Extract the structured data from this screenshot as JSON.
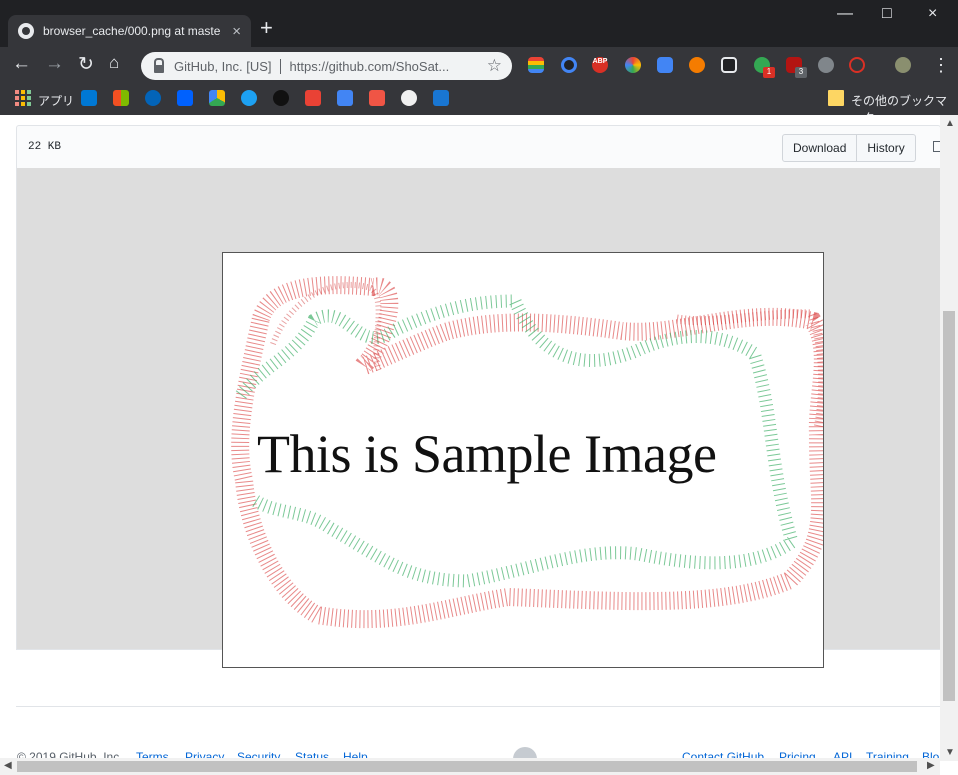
{
  "browser": {
    "tab_title": "browser_cache/000.png at maste",
    "tab_close": "×",
    "new_tab": "+",
    "window_controls": [
      "—",
      "□",
      "×"
    ],
    "omnibox_site": "GitHub, Inc. [US]",
    "omnibox_url": "https://github.com/ShoSat...",
    "star": "☆",
    "menu": "⋮",
    "nav_icons": [
      "back-icon",
      "forward-icon",
      "reload-icon",
      "home-icon"
    ],
    "extensions": [
      {
        "name": "stack-extension-icon",
        "color": "#34a853"
      },
      {
        "name": "color-extension-icon",
        "color": "#4285f4"
      },
      {
        "name": "adblock-extension-icon",
        "color": "#d93025",
        "label": "ABP"
      },
      {
        "name": "colorful-extension-icon",
        "color": "#fbbc04"
      },
      {
        "name": "translate-extension-icon",
        "color": "#4285f4"
      },
      {
        "name": "owl-extension-icon",
        "color": "#f57c00"
      },
      {
        "name": "video-extension-icon",
        "color": "#5f6368"
      },
      {
        "name": "green-extension-icon",
        "color": "#34a853",
        "badge": "1"
      },
      {
        "name": "ublock-extension-icon",
        "color": "#b31412",
        "badge": "3"
      },
      {
        "name": "lamp-extension-icon",
        "color": "#80868b"
      },
      {
        "name": "block-extension-icon",
        "color": "#d93025"
      }
    ]
  },
  "bookmarks": {
    "apps_label": "アプリ",
    "other_label": "その他のブックマーク",
    "items": [
      "bing-bookmark-icon",
      "microsoft-bookmark-icon",
      "onedrive-bookmark-icon",
      "dropbox-bookmark-icon",
      "drive-bookmark-icon",
      "twitter-bookmark-icon",
      "apple-bookmark-icon",
      "star-bookmark-icon",
      "cloud-bookmark-icon",
      "anki-bookmark-icon",
      "github-bookmark-icon",
      "code-bookmark-icon"
    ]
  },
  "github": {
    "file_size": "22 KB",
    "download_label": "Download",
    "history_label": "History",
    "sample_text": "This is Sample Image"
  },
  "footer": {
    "copyright": "© 2019 GitHub, Inc.",
    "left_links": [
      "Terms",
      "Privacy",
      "Security",
      "Status",
      "Help"
    ],
    "right_links": [
      "Contact GitHub",
      "Pricing",
      "API",
      "Training",
      "Blo"
    ]
  }
}
